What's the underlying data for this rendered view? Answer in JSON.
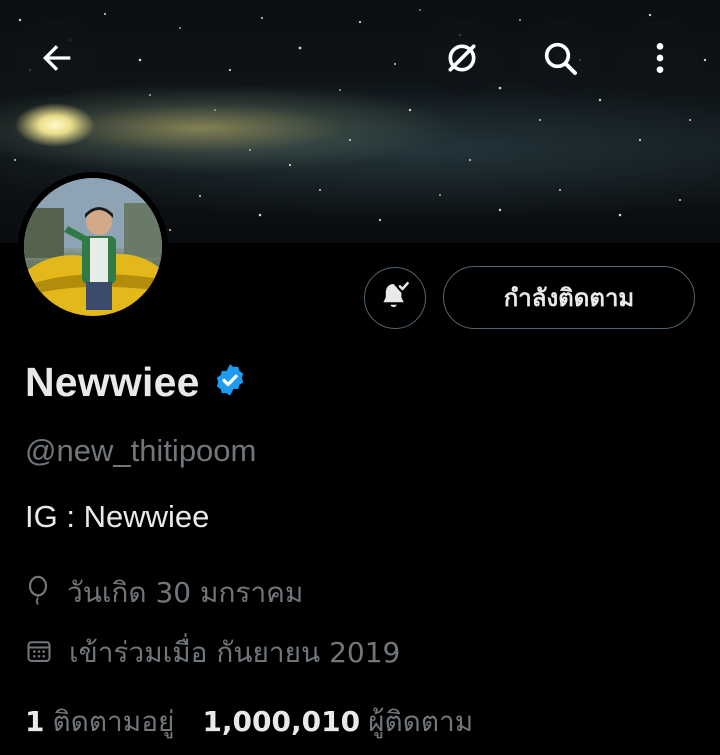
{
  "header": {
    "back_icon": "arrow-left-icon",
    "grok_icon": "slash-circle-icon",
    "search_icon": "search-icon",
    "more_icon": "more-vertical-icon"
  },
  "profile": {
    "name": "Newwiee",
    "verified": true,
    "verified_color": "#1d9bf0",
    "handle": "@new_thitipoom",
    "bio": "IG : Newwiee",
    "birthday": "วันเกิด 30 มกราคม",
    "joined": "เข้าร่วมเมื่อ กันยายน 2019"
  },
  "actions": {
    "notify_icon": "bell-check-icon",
    "following_label": "กำลังติดตาม"
  },
  "stats": {
    "following_count": "1",
    "following_label": "ติดตามอยู่",
    "followers_count": "1,000,010",
    "followers_label": "ผู้ติดตาม"
  },
  "colors": {
    "background": "#000000",
    "text_primary": "#e7e9ea",
    "text_secondary": "#71767b",
    "border": "#536471"
  }
}
